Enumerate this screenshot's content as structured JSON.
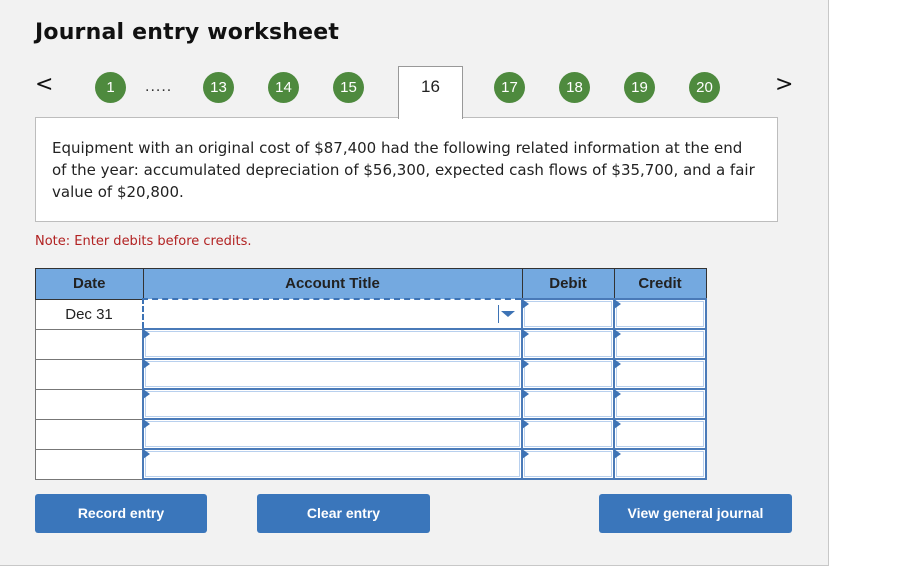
{
  "title": "Journal entry worksheet",
  "navigation": {
    "prev_icon": "chevron-left-icon",
    "next_icon": "chevron-right-icon",
    "prev_label": "<",
    "next_label": ">",
    "ellipsis": ".....",
    "steps": [
      "1",
      "13",
      "14",
      "15",
      "16",
      "17",
      "18",
      "19",
      "20"
    ],
    "active_step": "16",
    "completed_color": "#4e8a3e"
  },
  "question": {
    "text": "Equipment with an original cost of $87,400 had the following related information at the end of the year: accumulated depreciation of $56,300, expected cash flows of $35,700, and a fair value of $20,800."
  },
  "note": "Note: Enter debits before credits.",
  "table": {
    "headers": [
      "Date",
      "Account Title",
      "Debit",
      "Credit"
    ],
    "rows": [
      {
        "date": "Dec 31",
        "account": "",
        "debit": "",
        "credit": ""
      },
      {
        "date": "",
        "account": "",
        "debit": "",
        "credit": ""
      },
      {
        "date": "",
        "account": "",
        "debit": "",
        "credit": ""
      },
      {
        "date": "",
        "account": "",
        "debit": "",
        "credit": ""
      },
      {
        "date": "",
        "account": "",
        "debit": "",
        "credit": ""
      },
      {
        "date": "",
        "account": "",
        "debit": "",
        "credit": ""
      }
    ],
    "header_color": "#74a9e0"
  },
  "buttons": {
    "record": "Record entry",
    "clear": "Clear entry",
    "view_journal": "View general journal",
    "color": "#3a76bb"
  }
}
